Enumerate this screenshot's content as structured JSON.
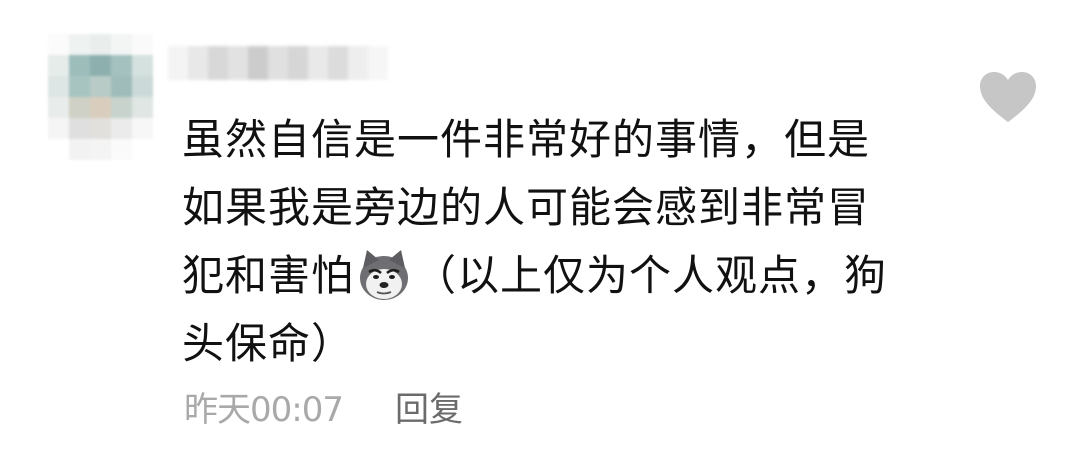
{
  "comment": {
    "text_lines": [
      "虽然自信是一件非常好的事情，但是",
      "如果我是旁边的人可能会感到非常冒",
      "犯和害怕",
      "（以上仅为个人观点，狗",
      "头保命）"
    ],
    "emoji": "dog-head-emoji",
    "timestamp": "昨天00:07",
    "reply_label": "回复",
    "like_icon": "heart-icon"
  },
  "colors": {
    "text": "#111111",
    "timestamp": "#a9a9a9",
    "reply": "#6b6b6b",
    "heart": "#c6c6c6"
  }
}
